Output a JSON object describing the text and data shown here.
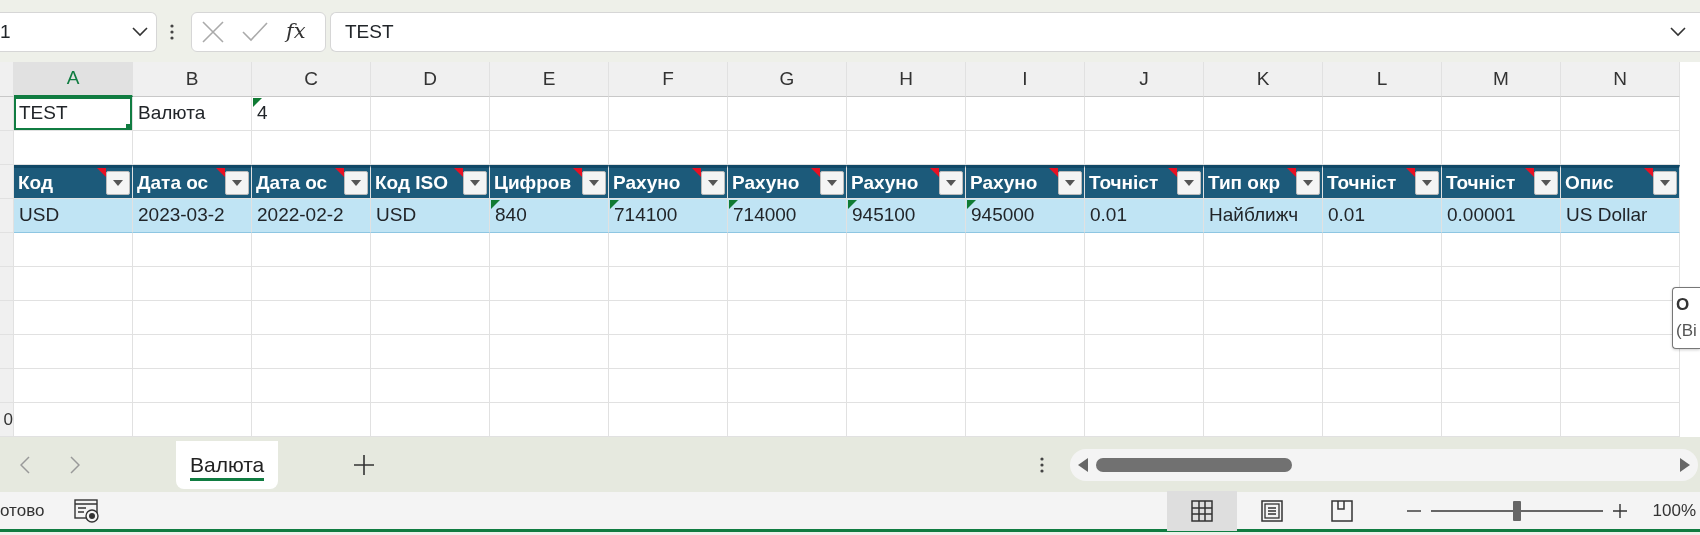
{
  "formula_bar": {
    "name_box": "1",
    "fx": "fx",
    "formula": "TEST"
  },
  "columns": [
    {
      "label": "A",
      "selected": true
    },
    {
      "label": "B",
      "selected": false
    },
    {
      "label": "C",
      "selected": false
    },
    {
      "label": "D",
      "selected": false
    },
    {
      "label": "E",
      "selected": false
    },
    {
      "label": "F",
      "selected": false
    },
    {
      "label": "G",
      "selected": false
    },
    {
      "label": "H",
      "selected": false
    },
    {
      "label": "I",
      "selected": false
    },
    {
      "label": "J",
      "selected": false
    },
    {
      "label": "K",
      "selected": false
    },
    {
      "label": "L",
      "selected": false
    },
    {
      "label": "M",
      "selected": false
    },
    {
      "label": "N",
      "selected": false
    }
  ],
  "row_1": [
    {
      "text": "TEST",
      "selected": true,
      "flag": false
    },
    {
      "text": "Валюта",
      "selected": false,
      "flag": false
    },
    {
      "text": "4",
      "selected": false,
      "flag": true
    }
  ],
  "table": {
    "headers": [
      {
        "text": "Код",
        "comment": true
      },
      {
        "text": "Дата ос",
        "comment": true
      },
      {
        "text": "Дата ос",
        "comment": true
      },
      {
        "text": "Код ISO",
        "comment": true
      },
      {
        "text": "Цифров",
        "comment": true
      },
      {
        "text": "Рахуно",
        "comment": true
      },
      {
        "text": "Рахуно",
        "comment": true
      },
      {
        "text": "Рахуно",
        "comment": true
      },
      {
        "text": "Рахуно",
        "comment": true
      },
      {
        "text": "Точніст",
        "comment": true
      },
      {
        "text": "Тип окр",
        "comment": true
      },
      {
        "text": "Точніст",
        "comment": true
      },
      {
        "text": "Точніст",
        "comment": true
      },
      {
        "text": "Опис",
        "comment": true
      }
    ],
    "rows": [
      [
        {
          "text": "USD",
          "flag": false
        },
        {
          "text": "2023-03-2",
          "flag": false
        },
        {
          "text": "2022-02-2",
          "flag": false
        },
        {
          "text": "USD",
          "flag": false
        },
        {
          "text": "840",
          "flag": true
        },
        {
          "text": "714100",
          "flag": true
        },
        {
          "text": "714000",
          "flag": true
        },
        {
          "text": "945100",
          "flag": true
        },
        {
          "text": "945000",
          "flag": true
        },
        {
          "text": "0.01",
          "flag": false
        },
        {
          "text": "Найближч",
          "flag": false
        },
        {
          "text": "0.01",
          "flag": false
        },
        {
          "text": "0.00001",
          "flag": false
        },
        {
          "text": "US Dollar",
          "flag": false
        }
      ]
    ]
  },
  "last_row_label": "0",
  "tooltip": {
    "title": "О",
    "body": "(Ві"
  },
  "sheet_tabs": [
    {
      "label": "Валюта",
      "selected": true
    }
  ],
  "status": {
    "text": "отово",
    "views": [
      {
        "kind": "normal",
        "selected": true
      },
      {
        "kind": "page_layout",
        "selected": false
      },
      {
        "kind": "page_break",
        "selected": false
      }
    ],
    "zoom": {
      "level": 0.5,
      "reading": "100%"
    }
  }
}
